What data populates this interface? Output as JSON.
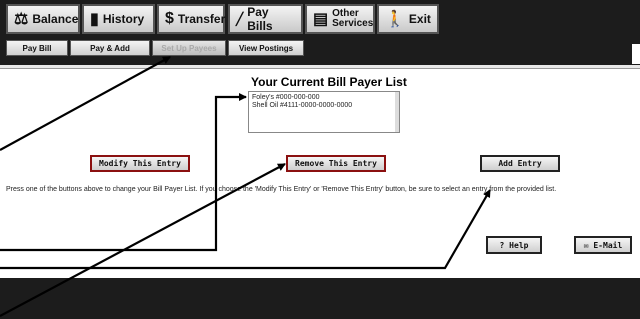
{
  "nav": {
    "balance": "Balance",
    "history": "History",
    "transfer": "Transfer",
    "pay_bills": "Pay Bills",
    "other_line1": "Other",
    "other_line2": "Services",
    "exit": "Exit"
  },
  "subnav": {
    "pay_bill": "Pay Bill",
    "pay_add": "Pay & Add",
    "set_up_payees": "Set Up Payees",
    "view_postings": "View Postings"
  },
  "page": {
    "title": "Your Current Bill Payer List",
    "payees": [
      "Foley's #000-000-000",
      "Shell Oil #4111-0000-0000-0000"
    ],
    "instructions": "Press one of the buttons above to change your Bill Payer List. If you choose the 'Modify This Entry' or 'Remove This Entry' button, be sure to select an entry from the provided list."
  },
  "buttons": {
    "modify": "Modify This Entry",
    "remove": "Remove This Entry",
    "add": "Add Entry",
    "help": "? Help",
    "email": "✉ E-Mail"
  },
  "colors": {
    "bar": "#1c1c1c",
    "button_border_red": "#8b1010"
  },
  "icons": {
    "balance": "scale-icon",
    "history": "book-icon",
    "transfer": "dollar-icon",
    "pay_bills": "pen-icon",
    "other_services": "cash-register-icon",
    "exit": "walking-figure-icon"
  }
}
